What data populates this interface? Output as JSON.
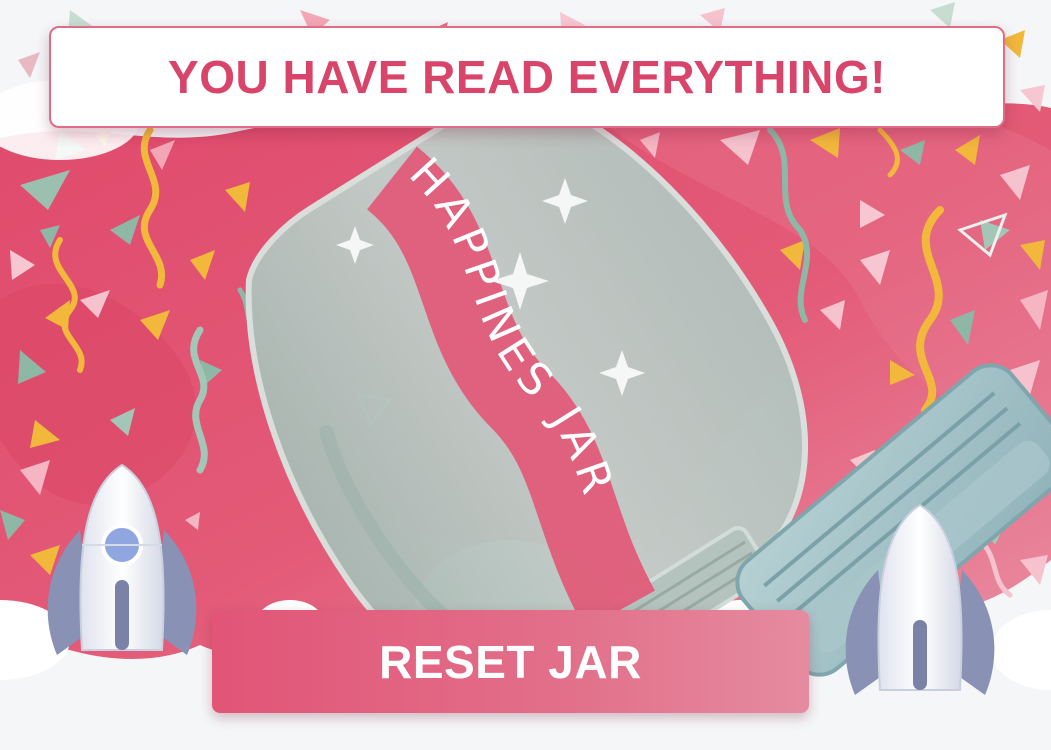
{
  "banner": {
    "title": "YOU HAVE READ EVERYTHING!"
  },
  "jar": {
    "ribbon_label": "HAPPINES JAR"
  },
  "actions": {
    "reset_label": "RESET JAR"
  },
  "colors": {
    "page_background": "#f5f6f8",
    "backdrop": "#e15373",
    "accent": "#d9456a",
    "button": "#e15577",
    "jar_glass": "#b9c6c1",
    "lid": "#9ebec4",
    "confetti_gold": "#f1b83c",
    "confetti_sage": "#8eb7a6",
    "confetti_pink": "#f4a6b6"
  },
  "icons": [
    "sparkle-icon",
    "rocket-icon",
    "jar-lid-icon",
    "streamer-icon",
    "confetti-icon"
  ]
}
